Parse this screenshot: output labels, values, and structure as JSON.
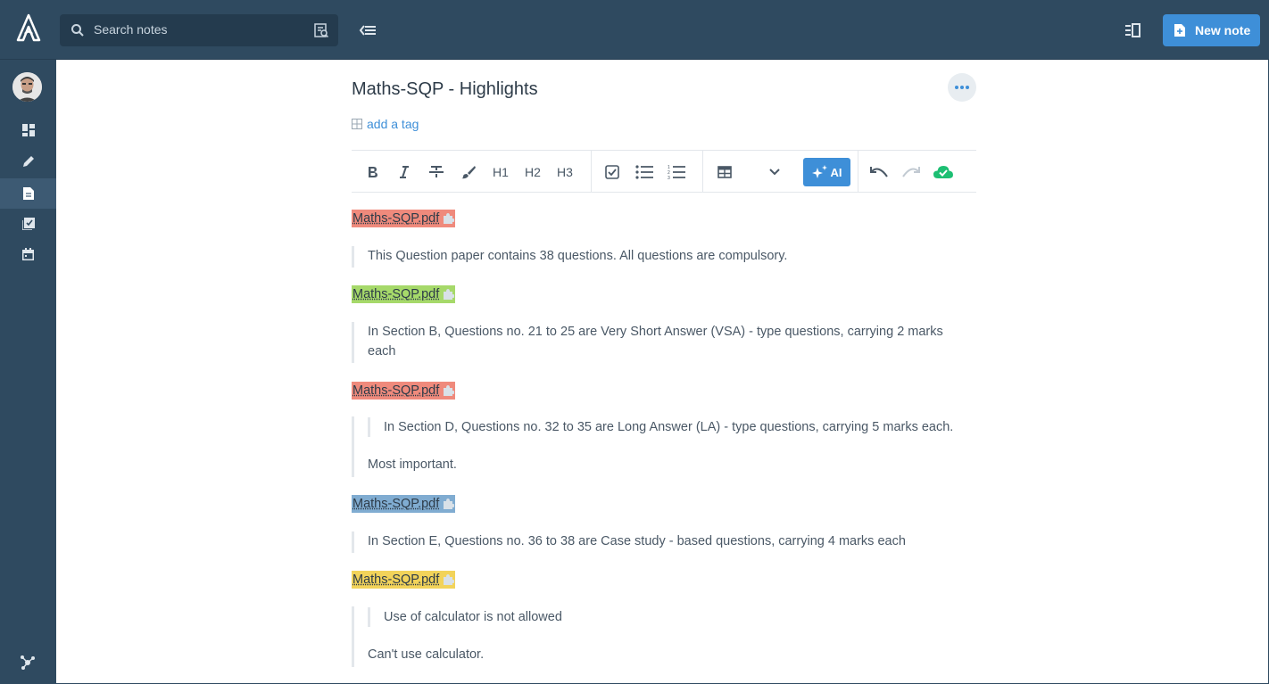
{
  "header": {
    "search_placeholder": "Search notes",
    "new_note_label": "New note"
  },
  "sidebar": {
    "items": [
      {
        "name": "dashboard",
        "icon": "dashboard-icon"
      },
      {
        "name": "jots",
        "icon": "pencil-icon"
      },
      {
        "name": "notes",
        "icon": "note-icon",
        "active": true
      },
      {
        "name": "tasks",
        "icon": "tasks-icon"
      },
      {
        "name": "calendar",
        "icon": "calendar-icon"
      }
    ]
  },
  "note": {
    "title": "Maths-SQP - Highlights",
    "add_tag": "add a tag",
    "toolbar": {
      "h1": "H1",
      "h2": "H2",
      "h3": "H3",
      "ai": "AI"
    },
    "blocks": [
      {
        "highlight": "Maths-SQP.pdf",
        "color": "#ef8a7c",
        "quote": "This Question paper contains 38 questions. All questions are compulsory."
      },
      {
        "highlight": "Maths-SQP.pdf",
        "color": "#a6d96a",
        "quote_line1": "In Section B, Questions no. 21 to 25 are Very Short Answer (VSA) - type questions, carrying 2 marks",
        "quote_line2": "each"
      },
      {
        "highlight": "Maths-SQP.pdf",
        "color": "#ef8a7c",
        "nested_quote": "In Section D, Questions no. 32 to 35 are Long Answer (LA) - type questions, carrying 5 marks each.",
        "comment": "Most important."
      },
      {
        "highlight": "Maths-SQP.pdf",
        "color": "#80acd1",
        "quote": "In Section E, Questions no. 36 to 38 are Case study - based questions, carrying 4 marks each"
      },
      {
        "highlight": "Maths-SQP.pdf",
        "color": "#f2d35a",
        "nested_quote": "Use of calculator is not allowed",
        "comment": "Can't use calculator."
      }
    ]
  },
  "colors": {
    "topbar": "#2f4a60",
    "accent": "#3e8fd8",
    "sync_ok": "#1dbf73"
  }
}
